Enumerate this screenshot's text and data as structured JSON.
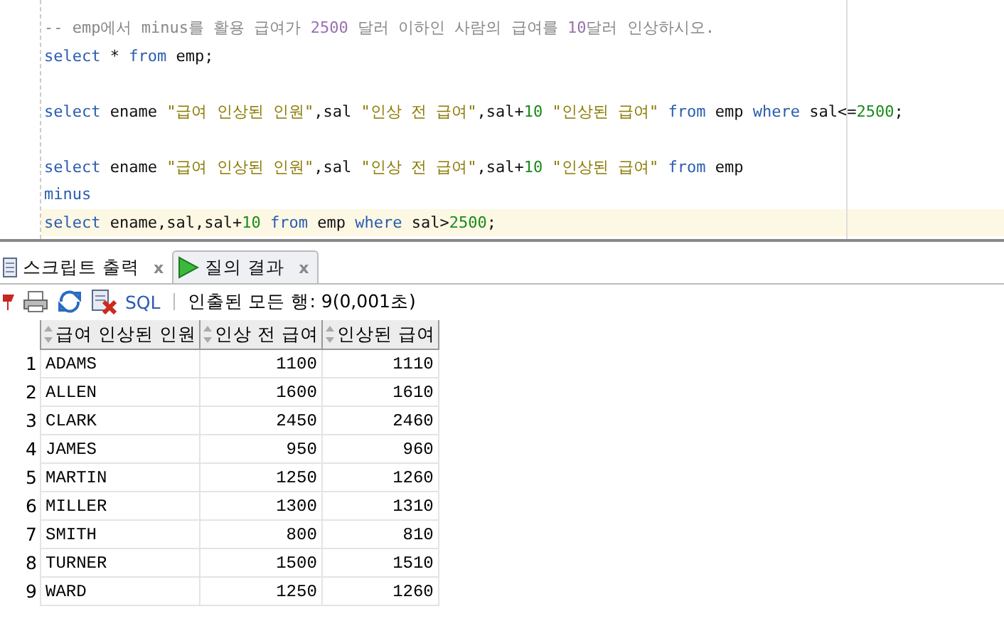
{
  "editor": {
    "lines": [
      {
        "current": false,
        "tokens": [
          {
            "kind": "comment",
            "text": "-- emp에서 minus를 활용 급여가 "
          },
          {
            "kind": "comment-number",
            "text": "2500"
          },
          {
            "kind": "comment",
            "text": " 달러 이하인 사람의 급여를 "
          },
          {
            "kind": "comment-number",
            "text": "10"
          },
          {
            "kind": "comment",
            "text": "달러 인상하시오."
          }
        ]
      },
      {
        "current": false,
        "tokens": [
          {
            "kind": "keyword",
            "text": "select"
          },
          {
            "kind": "plain",
            "text": " * "
          },
          {
            "kind": "keyword",
            "text": "from"
          },
          {
            "kind": "plain",
            "text": " emp;"
          }
        ]
      },
      {
        "current": false
      },
      {
        "current": false,
        "tokens": [
          {
            "kind": "keyword",
            "text": "select"
          },
          {
            "kind": "plain",
            "text": " ename "
          },
          {
            "kind": "string",
            "text": "\"급여 인상된 인원\""
          },
          {
            "kind": "plain",
            "text": ",sal "
          },
          {
            "kind": "string",
            "text": "\"인상 전 급여\""
          },
          {
            "kind": "plain",
            "text": ",sal+"
          },
          {
            "kind": "number",
            "text": "10"
          },
          {
            "kind": "string",
            "text": " \"인상된 급여\""
          },
          {
            "kind": "keyword",
            "text": " from"
          },
          {
            "kind": "plain",
            "text": " emp "
          },
          {
            "kind": "keyword",
            "text": "where"
          },
          {
            "kind": "plain",
            "text": " sal<="
          },
          {
            "kind": "number",
            "text": "2500"
          },
          {
            "kind": "plain",
            "text": ";"
          }
        ]
      },
      {
        "current": false
      },
      {
        "current": false,
        "tokens": [
          {
            "kind": "keyword",
            "text": "select"
          },
          {
            "kind": "plain",
            "text": " ename "
          },
          {
            "kind": "string",
            "text": "\"급여 인상된 인원\""
          },
          {
            "kind": "plain",
            "text": ",sal "
          },
          {
            "kind": "string",
            "text": "\"인상 전 급여\""
          },
          {
            "kind": "plain",
            "text": ",sal+"
          },
          {
            "kind": "number",
            "text": "10"
          },
          {
            "kind": "string",
            "text": " \"인상된 급여\""
          },
          {
            "kind": "keyword",
            "text": " from"
          },
          {
            "kind": "plain",
            "text": " emp"
          }
        ]
      },
      {
        "current": false,
        "tokens": [
          {
            "kind": "keyword",
            "text": "minus"
          }
        ]
      },
      {
        "current": true,
        "tokens": [
          {
            "kind": "keyword",
            "text": "select"
          },
          {
            "kind": "plain",
            "text": " ename,sal,sal+"
          },
          {
            "kind": "number",
            "text": "10"
          },
          {
            "kind": "keyword",
            "text": " from"
          },
          {
            "kind": "plain",
            "text": " emp "
          },
          {
            "kind": "keyword",
            "text": "where"
          },
          {
            "kind": "plain",
            "text": " sal>"
          },
          {
            "kind": "number",
            "text": "2500"
          },
          {
            "kind": "plain",
            "text": ";"
          }
        ]
      }
    ]
  },
  "tabs": [
    {
      "label": "스크립트 출력",
      "close": "x",
      "kind": "script",
      "selected": false
    },
    {
      "label": "질의 결과",
      "close": "x",
      "kind": "query",
      "selected": true
    }
  ],
  "toolbar": {
    "sql_link": "SQL",
    "status": "인출된 모든 행: 9(0,001초)"
  },
  "table": {
    "columns": [
      "급여 인상된 인원",
      "인상 전 급여",
      "인상된 급여"
    ],
    "rows": [
      {
        "num": "1",
        "cells": [
          "ADAMS",
          "1100",
          "1110"
        ]
      },
      {
        "num": "2",
        "cells": [
          "ALLEN",
          "1600",
          "1610"
        ]
      },
      {
        "num": "3",
        "cells": [
          "CLARK",
          "2450",
          "2460"
        ]
      },
      {
        "num": "4",
        "cells": [
          "JAMES",
          "950",
          "960"
        ]
      },
      {
        "num": "5",
        "cells": [
          "MARTIN",
          "1250",
          "1260"
        ]
      },
      {
        "num": "6",
        "cells": [
          "MILLER",
          "1300",
          "1310"
        ]
      },
      {
        "num": "7",
        "cells": [
          "SMITH",
          "800",
          "810"
        ]
      },
      {
        "num": "8",
        "cells": [
          "TURNER",
          "1500",
          "1510"
        ]
      },
      {
        "num": "9",
        "cells": [
          "WARD",
          "1250",
          "1260"
        ]
      }
    ]
  }
}
